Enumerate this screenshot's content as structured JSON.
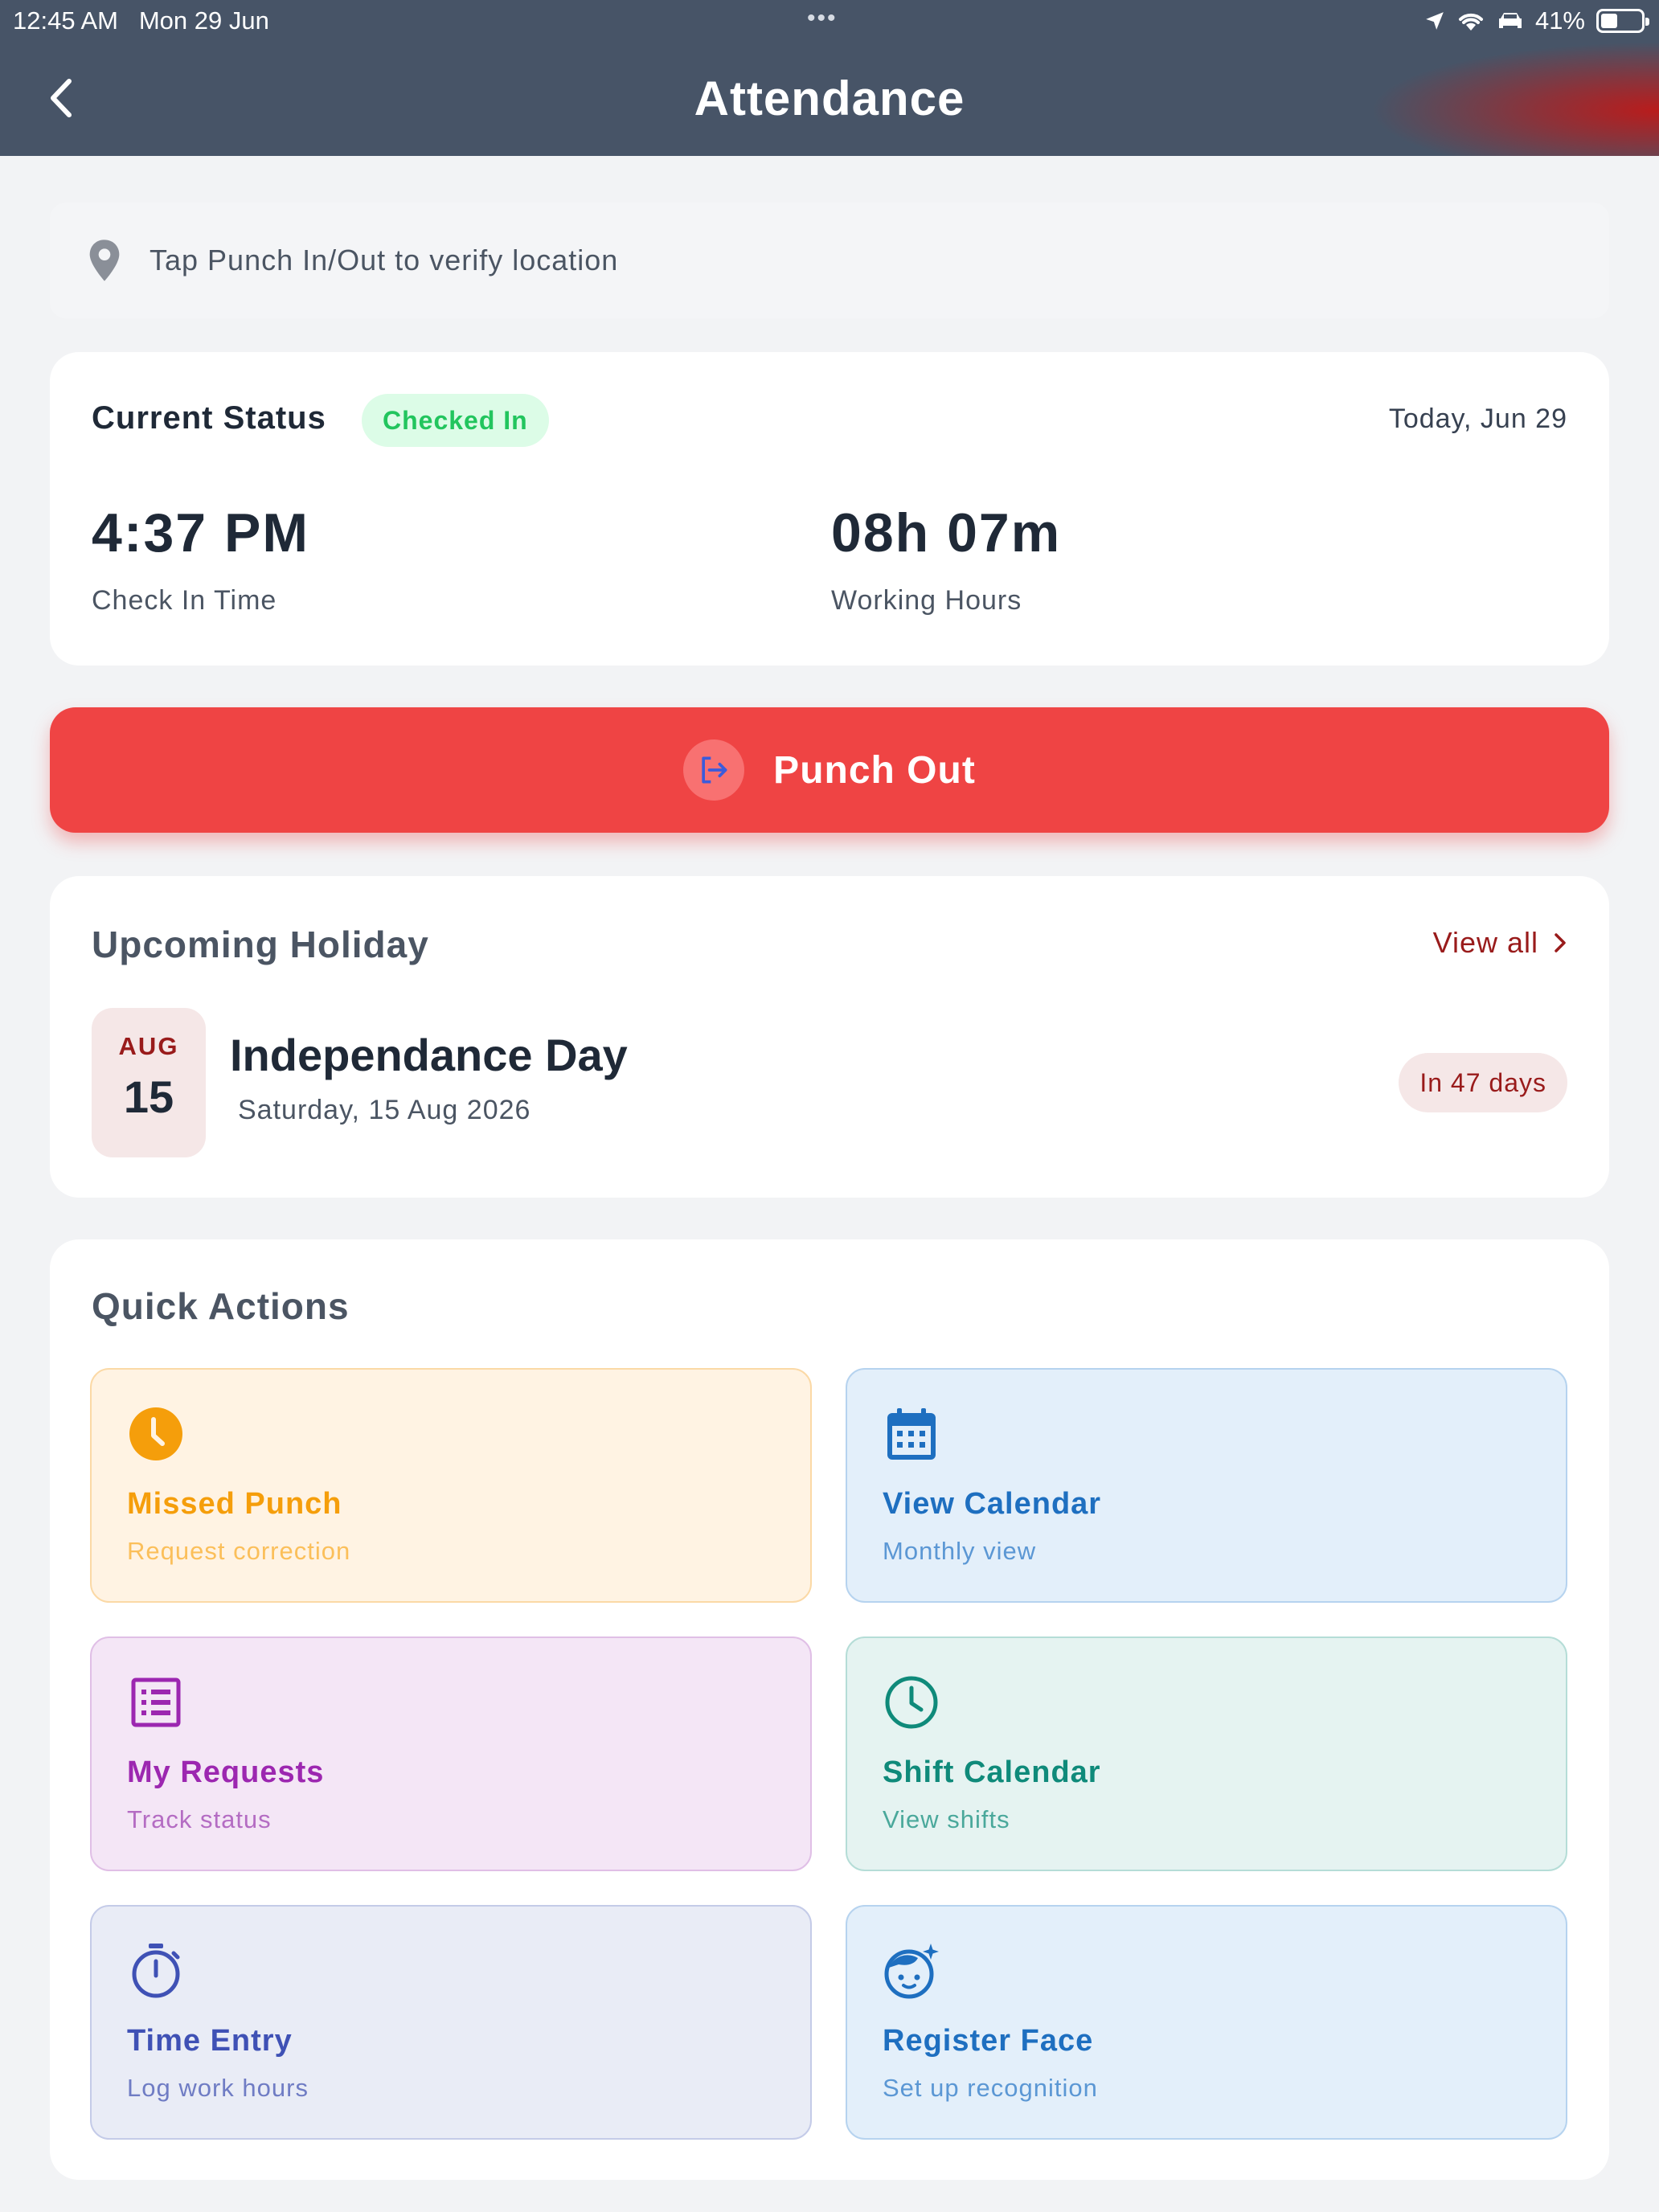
{
  "status_bar": {
    "time": "12:45 AM",
    "date": "Mon 29 Jun",
    "battery": "41%",
    "battery_level": 0.41
  },
  "nav": {
    "title": "Attendance",
    "back_icon": "chevron-left-icon"
  },
  "location": {
    "icon": "map-pin-icon",
    "text": "Tap Punch In/Out to verify location"
  },
  "status": {
    "label": "Current Status",
    "badge": "Checked In",
    "date": "Today, Jun 29",
    "check_in_value": "4:37 PM",
    "check_in_label": "Check In Time",
    "hours_value": "08h 07m",
    "hours_label": "Working Hours"
  },
  "punch": {
    "label": "Punch Out",
    "icon": "logout-icon"
  },
  "holiday": {
    "title": "Upcoming Holiday",
    "view_all": "View all",
    "month": "AUG",
    "day": "15",
    "name": "Independance Day",
    "date": "Saturday, 15 Aug 2026",
    "countdown": "In 47 days"
  },
  "quick_actions": {
    "title": "Quick Actions",
    "items": [
      {
        "name": "Missed Punch",
        "sub": "Request correction",
        "icon": "clock-filled-icon",
        "color": "#f59e0b"
      },
      {
        "name": "View Calendar",
        "sub": "Monthly view",
        "icon": "calendar-icon",
        "color": "#1e6fc0"
      },
      {
        "name": "My Requests",
        "sub": "Track status",
        "icon": "list-icon",
        "color": "#9c27b0"
      },
      {
        "name": "Shift Calendar",
        "sub": "View shifts",
        "icon": "clock-outline-icon",
        "color": "#0f8a7a"
      },
      {
        "name": "Time Entry",
        "sub": "Log work hours",
        "icon": "stopwatch-icon",
        "color": "#3f51b5"
      },
      {
        "name": "Register Face",
        "sub": "Set up recognition",
        "icon": "face-icon",
        "color": "#1e6fc0"
      }
    ]
  }
}
